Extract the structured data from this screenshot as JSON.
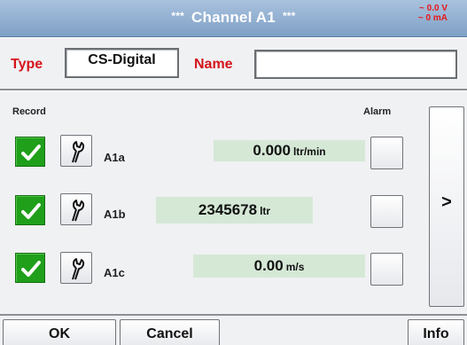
{
  "header": {
    "stars_left": "***",
    "title": "Channel A1",
    "stars_right": "***",
    "status_voltage": "~ 0.0 V",
    "status_current": "~ 0 mA"
  },
  "type_row": {
    "type_label": "Type",
    "type_value": "CS-Digital",
    "name_label": "Name",
    "name_value": ""
  },
  "table": {
    "record_header": "Record",
    "alarm_header": "Alarm",
    "rows": [
      {
        "checked": true,
        "channel": "A1a",
        "value": "0.000",
        "unit": "ltr/min"
      },
      {
        "checked": true,
        "channel": "A1b",
        "value": "2345678",
        "unit": "ltr"
      },
      {
        "checked": true,
        "channel": "A1c",
        "value": "0.00",
        "unit": "m/s"
      }
    ]
  },
  "side_button": {
    "label": ">"
  },
  "footer": {
    "ok_label": "OK",
    "cancel_label": "Cancel",
    "info_label": "Info"
  },
  "colors": {
    "accent_red": "#d5141b",
    "title_blue": "#8fabd0",
    "check_green": "#1f9f1a",
    "value_bg": "#d5e8d6"
  }
}
